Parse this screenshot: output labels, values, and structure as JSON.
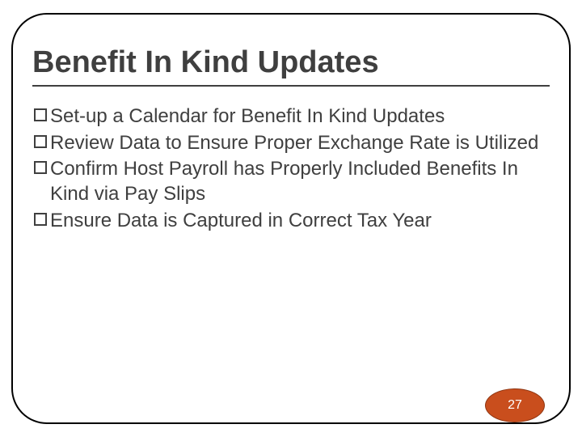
{
  "slide": {
    "title": "Benefit In Kind Updates",
    "bullets": [
      "Set-up a Calendar for Benefit In Kind Updates",
      "Review Data to Ensure Proper Exchange Rate is Utilized",
      "Confirm Host Payroll has Properly Included Benefits In Kind via Pay Slips",
      "Ensure Data is Captured in Correct Tax Year"
    ],
    "page_number": "27"
  }
}
